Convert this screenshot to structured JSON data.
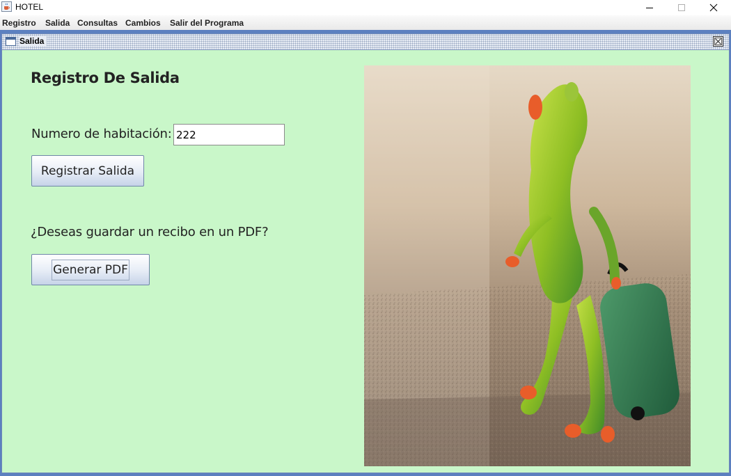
{
  "window": {
    "title": "HOTEL",
    "icon": "java-cup-icon",
    "controls": [
      "minimize-icon",
      "maximize-icon",
      "close-icon"
    ]
  },
  "menubar": {
    "items": [
      "Registro",
      "Salida",
      "Consultas",
      "Cambios",
      "Salir del Programa"
    ]
  },
  "internal_frame": {
    "title": "Salida",
    "icon": "frame-icon",
    "close_icon": "close-icon"
  },
  "form": {
    "heading": "Registro De Salida",
    "room_label": "Numero de habitación:",
    "room_value": "222",
    "register_button": "Registrar Salida",
    "pdf_question": "¿Deseas guardar un recibo en un PDF?",
    "pdf_button": "Generar PDF"
  },
  "image": {
    "subject": "frog-figurine-with-suitcase"
  },
  "colors": {
    "content_background": "#c9f7c9",
    "desktop_background": "#5c80c0"
  }
}
